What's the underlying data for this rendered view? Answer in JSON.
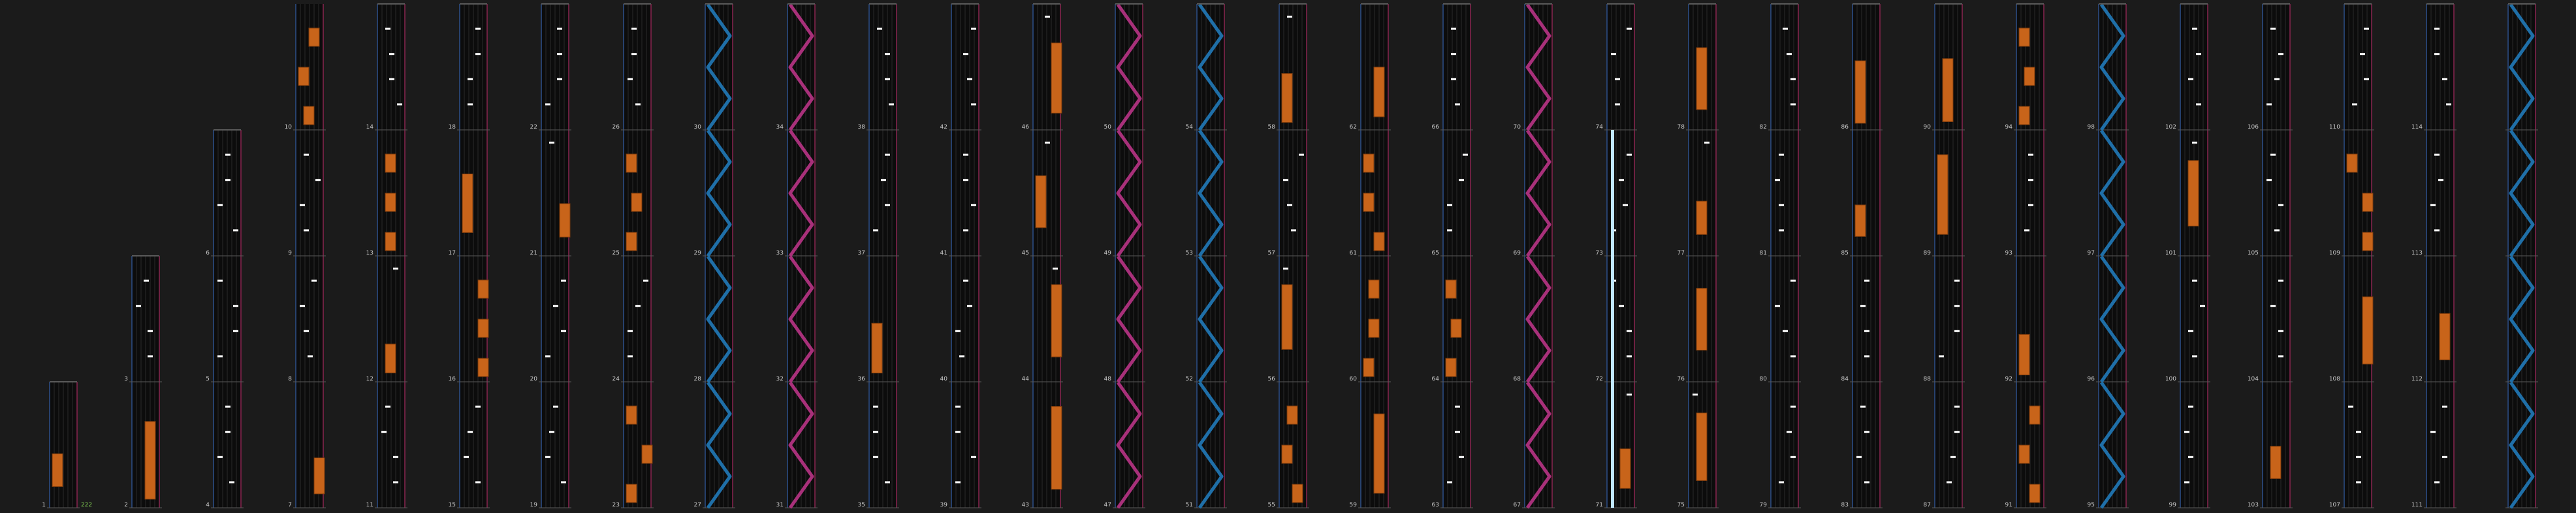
{
  "app": {
    "view": "beatmap-overview",
    "colors": {
      "background": "#1b1b1b",
      "lane_background": "#0c0c0c",
      "lane_grid": "#2a2a2a",
      "lane_edge_left": "#2c4f8a",
      "lane_edge_right": "#8a2450",
      "measure_line": "#5a5a5a",
      "measure_number": "#c8c8c8",
      "tap_note": "#ffffff",
      "hold_note": "#c8641a",
      "hold_note_border": "#7a3a0c",
      "slide_blue": "#1f6fa8",
      "slide_pink": "#a8307a",
      "bpm_marker": "#7ec850",
      "highlight": "#bfe6ff"
    }
  },
  "measures": {
    "labels": [
      "1",
      "2",
      "3",
      "4",
      "5",
      "6",
      "7",
      "8",
      "9",
      "10",
      "11",
      "12",
      "13",
      "14",
      "15",
      "16",
      "17",
      "18",
      "19",
      "20",
      "21",
      "22",
      "23",
      "24",
      "25",
      "26",
      "27",
      "28",
      "29",
      "30",
      "31",
      "32",
      "33",
      "34",
      "35",
      "36",
      "37",
      "38",
      "39",
      "40",
      "41",
      "42",
      "43",
      "44",
      "45",
      "46",
      "47",
      "48",
      "49",
      "50",
      "51",
      "52",
      "53",
      "54",
      "55",
      "56",
      "57",
      "58",
      "59",
      "60",
      "61",
      "62",
      "63",
      "64",
      "65",
      "66",
      "67",
      "68",
      "69",
      "70",
      "71",
      "72",
      "73",
      "74",
      "75",
      "76",
      "77",
      "78",
      "79",
      "80",
      "81",
      "82",
      "83",
      "84",
      "85",
      "86",
      "87",
      "88",
      "89",
      "90",
      "91",
      "92",
      "93",
      "94",
      "95",
      "96",
      "97",
      "98",
      "99",
      "100",
      "101",
      "102",
      "103",
      "104",
      "105",
      "106",
      "107",
      "108",
      "109",
      "110",
      "111",
      "112",
      "113",
      "114"
    ],
    "bpm_label": "222"
  }
}
